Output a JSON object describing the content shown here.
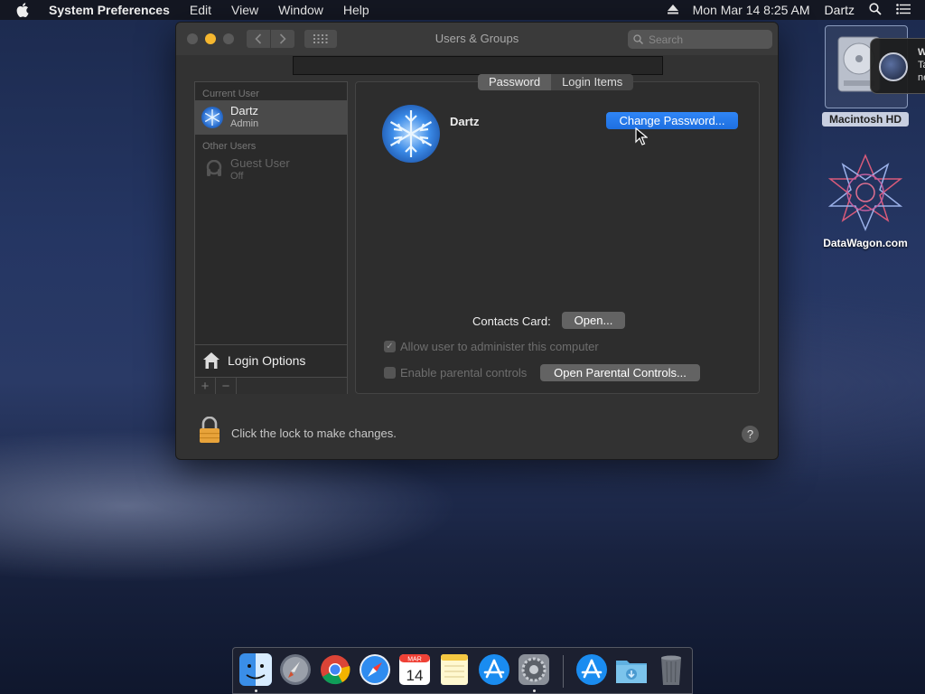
{
  "menubar": {
    "app_name": "System Preferences",
    "menus": [
      "Edit",
      "View",
      "Window",
      "Help"
    ],
    "datetime": "Mon Mar 14  8:25 AM",
    "user": "Dartz"
  },
  "window": {
    "title": "Users & Groups",
    "search_placeholder": "Search",
    "sidebar": {
      "current_user_header": "Current User",
      "current_user": {
        "name": "Dartz",
        "role": "Admin"
      },
      "other_users_header": "Other Users",
      "other_users": [
        {
          "name": "Guest User",
          "status": "Off"
        }
      ],
      "login_options_label": "Login Options",
      "add_label": "+",
      "remove_label": "−"
    },
    "tabs": [
      "Password",
      "Login Items"
    ],
    "user_name": "Dartz",
    "change_password_label": "Change Password...",
    "contacts_card_label": "Contacts Card:",
    "open_label": "Open...",
    "allow_admin_label": "Allow user to administer this computer",
    "allow_admin_checked": true,
    "parental_label": "Enable parental controls",
    "parental_checked": false,
    "open_parental_label": "Open Parental Controls...",
    "lock_text": "Click the lock to make changes.",
    "help_label": "?"
  },
  "desktop": {
    "hd_label": "Macintosh HD",
    "website_label": "DataWagon.com",
    "notification_text_1": "W",
    "notification_text_2": "Ta",
    "notification_text_3": "ne"
  },
  "dock": {
    "apps": [
      "finder",
      "launchpad",
      "chrome",
      "safari",
      "calendar",
      "notes",
      "app-store",
      "system-preferences",
      "app-store-downloads",
      "downloads-folder",
      "trash"
    ],
    "calendar_month": "MAR",
    "calendar_day": "14"
  },
  "colors": {
    "accent_blue": "#1e6fe0",
    "window_bg": "#323232",
    "lock_gold": "#e8a33a"
  }
}
